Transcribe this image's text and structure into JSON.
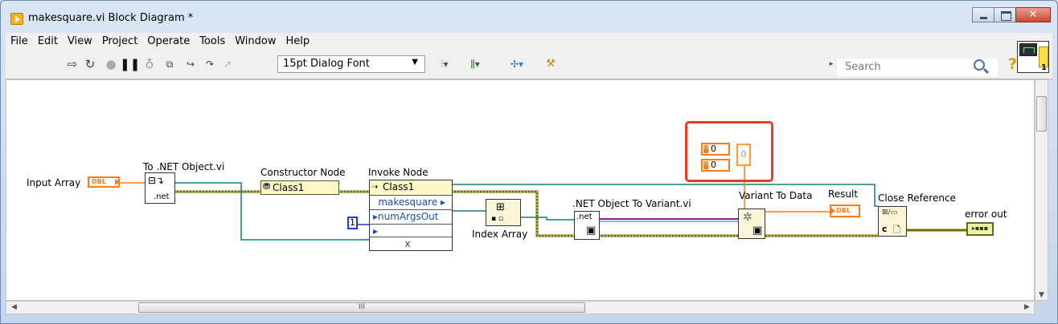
{
  "window": {
    "title": "makesquare.vi Block Diagram *",
    "controls": {
      "minimize": "—",
      "maximize": "□",
      "close": "✕"
    }
  },
  "menubar": {
    "items": [
      "File",
      "Edit",
      "View",
      "Project",
      "Operate",
      "Tools",
      "Window",
      "Help"
    ]
  },
  "toolbar": {
    "font": "15pt Dialog Font",
    "search_placeholder": "Search",
    "help": "?"
  },
  "vi_icon": {
    "connector_count": "1"
  },
  "diagram": {
    "input_array": {
      "label": "Input Array",
      "type": "DBL"
    },
    "to_net_object": {
      "label": "To .NET Object.vi",
      "glyph": ".net"
    },
    "constructor_node": {
      "label": "Constructor Node",
      "class": "Class1"
    },
    "invoke_node": {
      "label": "Invoke Node",
      "class": "Class1",
      "method": "makesquare",
      "param_numArgsOut": "numArgsOut",
      "param_x": "x"
    },
    "const_one": "1",
    "index_array": {
      "label": "Index Array"
    },
    "net_to_variant": {
      "label": ".NET Object To Variant.vi",
      "glyph": ".net"
    },
    "cluster_constant": {
      "values": [
        "0",
        "0"
      ],
      "output": "0"
    },
    "variant_to_data": {
      "label": "Variant To Data"
    },
    "result": {
      "label": "Result",
      "type": "DBL"
    },
    "close_reference": {
      "label": "Close Reference",
      "glyph": "c"
    },
    "error_out": {
      "label": "error out"
    }
  },
  "scrollbars": {
    "grip": "III"
  },
  "colors": {
    "orange_wire": "#ff7a1a",
    "refnum_wire": "#6b6b00",
    "teal_wire": "#137f7f",
    "variant_wire": "#8a2088",
    "highlight_border": "#e93b2d"
  }
}
